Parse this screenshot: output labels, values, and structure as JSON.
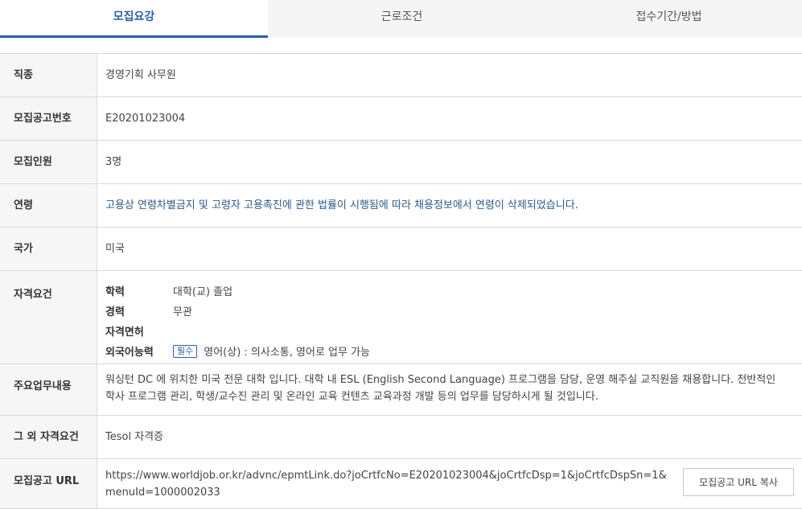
{
  "tabs": [
    {
      "label": "모집요강"
    },
    {
      "label": "근로조건"
    },
    {
      "label": "접수기간/방법"
    }
  ],
  "rows": {
    "job": {
      "label": "직종",
      "value": "경영기획 사무원"
    },
    "notice_no": {
      "label": "모집공고번호",
      "value": "E20201023004"
    },
    "headcount": {
      "label": "모집인원",
      "value": "3명"
    },
    "age": {
      "label": "연령",
      "value": "고용상 연령차별금지 및 고령자 고용촉진에 관한 법률이 시행됨에 따라 채용정보에서 연령이 삭제되었습니다."
    },
    "country": {
      "label": "국가",
      "value": "미국"
    },
    "qualification": {
      "label": "자격요건",
      "education": {
        "label": "학력",
        "value": "대학(교) 졸업"
      },
      "experience": {
        "label": "경력",
        "value": "무관"
      },
      "license": {
        "label": "자격면허",
        "value": ""
      },
      "language": {
        "label": "외국어능력",
        "badge": "필수",
        "value": "영어(상) : 의사소통, 영어로 업무 가능"
      }
    },
    "duty": {
      "label": "주요업무내용",
      "value": "워싱턴 DC 에 위치한 미국 전문 대학 입니다. 대학 내 ESL (English Second Language) 프로그램을 담당, 운영 해주실 교직원을 채용합니다. 전반적인 학사 프로그램 관리, 학생/교수진 관리 및 온라인 교육 컨텐츠 교육과정 개발 등의 업무를 담당하시게 될 것입니다."
    },
    "other_qual": {
      "label": "그 외 자격요건",
      "value": "Tesol 자격증"
    },
    "url": {
      "label": "모집공고 URL",
      "value": "https://www.worldjob.or.kr/advnc/epmtLink.do?joCrtfcNo=E20201023004&joCrtfcDsp=1&joCrtfcDspSn=1&menuId=1000002033",
      "copy_label": "모집공고 URL 복사"
    }
  }
}
